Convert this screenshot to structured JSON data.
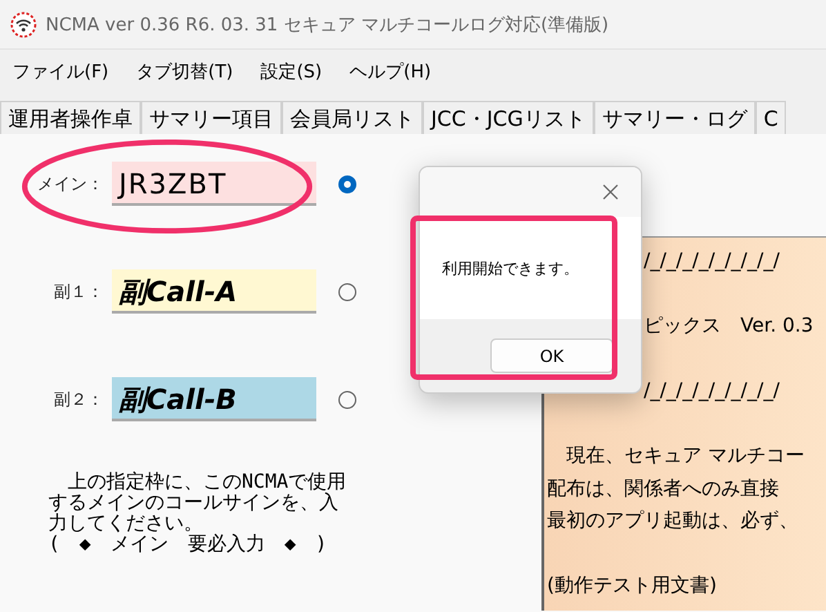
{
  "window": {
    "title": "NCMA ver 0.36  R6. 03. 31    セキュア マルチコールログ対応(準備版)"
  },
  "menu": [
    "ファイル(F)",
    "タブ切替(T)",
    "設定(S)",
    "ヘルプ(H)"
  ],
  "tabs": [
    "運用者操作卓",
    "サマリー項目",
    "会員局リスト",
    "JCC・JCGリスト",
    "サマリー・ログ",
    "C"
  ],
  "calls": [
    {
      "label": "メイン：",
      "value": "JR3ZBT",
      "kind": "main",
      "selected": true
    },
    {
      "label": "副１：",
      "value": "副Call-A",
      "kind": "sub-a",
      "selected": false
    },
    {
      "label": "副２：",
      "value": "副Call-B",
      "kind": "sub-b",
      "selected": false
    }
  ],
  "instructions": [
    "　上の指定枠に、このNCMAで使用",
    "するメインのコールサインを、入",
    "力してください。",
    "(　◆　メイン　要必入力　◆　)"
  ],
  "notice": [
    {
      "kind": "partial",
      "text": "/_/_/_/_/_/_/_/_/"
    },
    {
      "kind": "blank"
    },
    {
      "kind": "partial",
      "text": "ピックス　Ver. 0.3"
    },
    {
      "kind": "blank"
    },
    {
      "kind": "partial",
      "text": "/_/_/_/_/_/_/_/_/"
    },
    {
      "kind": "blank"
    },
    {
      "kind": "text",
      "text": "　現在、セキュア マルチコー"
    },
    {
      "kind": "text",
      "text": "配布は、関係者へのみ直接"
    },
    {
      "kind": "text",
      "text": "最初のアプリ起動は、必ず、"
    },
    {
      "kind": "blank"
    },
    {
      "kind": "text",
      "text": "(動作テスト用文書)"
    }
  ],
  "dialog": {
    "message": "利用開始できます。",
    "button": "OK"
  }
}
